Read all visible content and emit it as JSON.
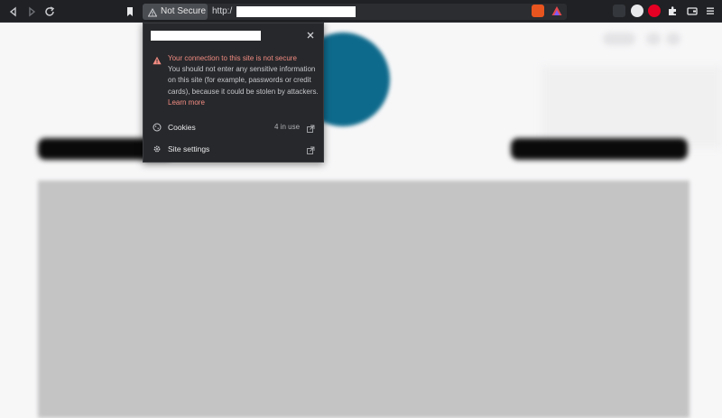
{
  "browser": {
    "security_chip_label": "Not Secure",
    "url_prefix": "http:/"
  },
  "site_info_popup": {
    "warning_title": "Your connection to this site is not secure",
    "warning_body": "You should not enter any sensitive information on this site (for example, passwords or credit cards), because it could be stolen by attackers.",
    "learn_more_label": "Learn more",
    "rows": [
      {
        "label": "Cookies",
        "meta": "4 in use",
        "icon": "cookie-icon"
      },
      {
        "label": "Site settings",
        "meta": "",
        "icon": "gear-icon"
      }
    ]
  },
  "colors": {
    "toolbar_bg": "#1f2124",
    "popup_bg": "#27282b",
    "warning_red": "#f28b82",
    "page_accent": "#0e6a8c"
  }
}
